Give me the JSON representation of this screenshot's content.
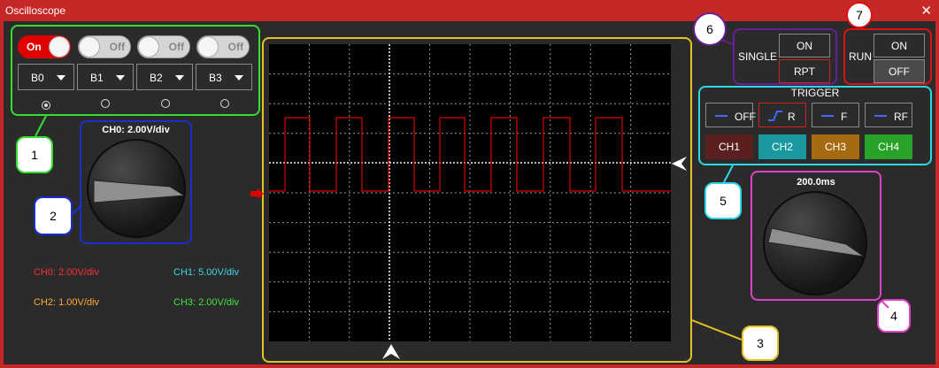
{
  "window": {
    "title": "Oscilloscope",
    "close_glyph": "✕"
  },
  "bits": [
    {
      "name": "B0",
      "state": "On",
      "on": true,
      "selected": true
    },
    {
      "name": "B1",
      "state": "Off",
      "on": false,
      "selected": false
    },
    {
      "name": "B2",
      "state": "Off",
      "on": false,
      "selected": false
    },
    {
      "name": "B3",
      "state": "Off",
      "on": false,
      "selected": false
    }
  ],
  "voltage_knob": {
    "label": "CH0: 2.00V/div"
  },
  "time_knob": {
    "label": "200.0ms"
  },
  "channel_scales": [
    {
      "text": "CH0: 2.00V/div",
      "color": "#ff3030"
    },
    {
      "text": "CH1: 5.00V/div",
      "color": "#3fd6e6"
    },
    {
      "text": "CH2: 1.00V/div",
      "color": "#ffaa33"
    },
    {
      "text": "CH3: 2.00V/div",
      "color": "#3fe63f"
    }
  ],
  "single": {
    "label": "SINGLE",
    "on": "ON",
    "rpt": "RPT"
  },
  "run": {
    "label": "RUN",
    "on": "ON",
    "off": "OFF"
  },
  "trigger": {
    "title": "TRIGGER",
    "modes": [
      {
        "label": "OFF"
      },
      {
        "label": "R"
      },
      {
        "label": "F"
      },
      {
        "label": "RF"
      }
    ],
    "channels": [
      {
        "label": "CH1",
        "color": "#5a1f1f"
      },
      {
        "label": "CH2",
        "color": "#1a9aa0"
      },
      {
        "label": "CH3",
        "color": "#a66a10"
      },
      {
        "label": "CH4",
        "color": "#27a327"
      }
    ]
  },
  "callouts": [
    "1",
    "2",
    "3",
    "4",
    "5",
    "6",
    "7"
  ],
  "colors": {
    "accent": "#c62828",
    "trace": "#e00000",
    "green": "#33dd33",
    "blue": "#1a2fd0",
    "yellow": "#e6c323",
    "magenta": "#e040c8",
    "cyan": "#2fd6e6",
    "purple": "#6b1e9c",
    "red": "#e01010"
  }
}
